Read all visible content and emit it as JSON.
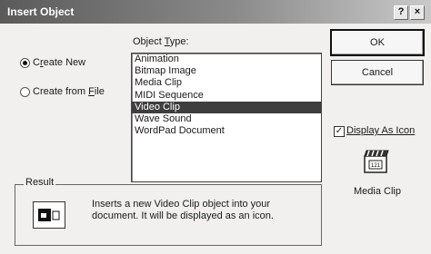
{
  "window": {
    "title": "Insert Object",
    "help_label": "?",
    "close_label": "×"
  },
  "options": {
    "create_new_pre": "C",
    "create_new_u": "r",
    "create_new_post": "eate New",
    "create_from_file_pre": "Create from ",
    "create_from_file_u": "F",
    "create_from_file_post": "ile"
  },
  "object_type": {
    "label_pre": "Object ",
    "label_u": "T",
    "label_post": "ype:",
    "items": [
      "Animation",
      "Bitmap Image",
      "Media Clip",
      "MIDI Sequence",
      "Video Clip",
      "Wave Sound",
      "WordPad Document"
    ],
    "selected_index": 4
  },
  "buttons": {
    "ok": "OK",
    "cancel": "Cancel"
  },
  "display_as_icon": {
    "label_pre": "",
    "label_u": "D",
    "label_post": "isplay As Icon",
    "checked": true,
    "check_glyph": "✓"
  },
  "icon_preview": {
    "icon_name": "media-clip-icon",
    "caption": "Media Clip"
  },
  "result": {
    "label": "Result",
    "line1": "Inserts a new Video Clip object into your",
    "line2": "document.  It will be displayed as an icon.",
    "icon_name": "object-icon"
  }
}
